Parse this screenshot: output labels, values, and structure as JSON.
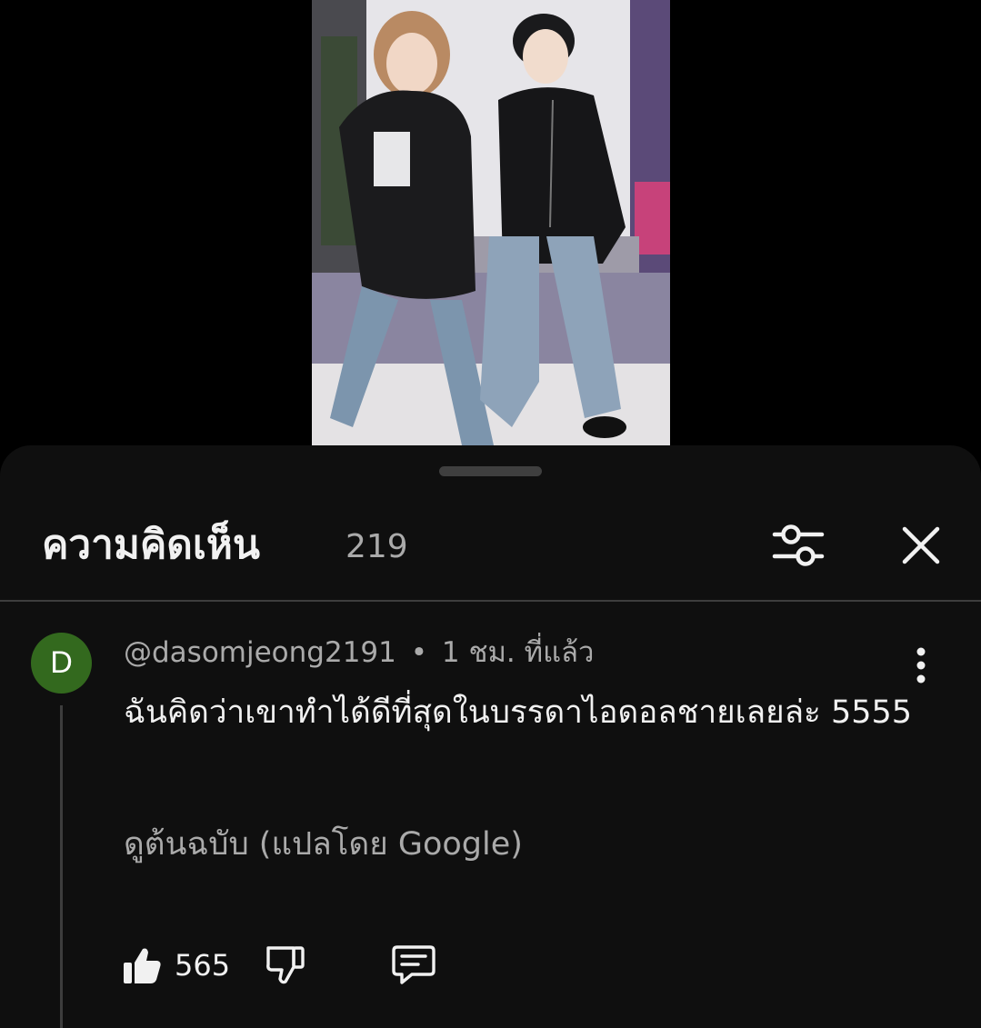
{
  "video": {
    "thumbnail": "two-people-in-black-hoodies-and-jeans-dancing"
  },
  "comments_panel": {
    "title": "ความคิดเห็น",
    "count": "219",
    "filter_icon": "sliders-icon",
    "close_icon": "close-icon"
  },
  "comment": {
    "avatar_letter": "D",
    "avatar_color": "#33691e",
    "author": "@dasomjeong2191",
    "separator": "•",
    "time": "1 ชม. ที่แล้ว",
    "text": "ฉันคิดว่าเขาทำได้ดีที่สุดในบรรดาไอดอลชายเลยล่ะ 5555",
    "translate_link": "ดูต้นฉบับ (แปลโดย Google)",
    "likes": "565",
    "more_icon": "more-vertical-icon",
    "like_icon": "thumbs-up-filled-icon",
    "dislike_icon": "thumbs-down-icon",
    "reply_icon": "reply-comment-icon"
  },
  "colors": {
    "sheet_bg": "#0f0f0f",
    "primary_text": "#f1f1f1",
    "secondary_text": "#aaaaaa",
    "divider": "#3d3d3d"
  }
}
